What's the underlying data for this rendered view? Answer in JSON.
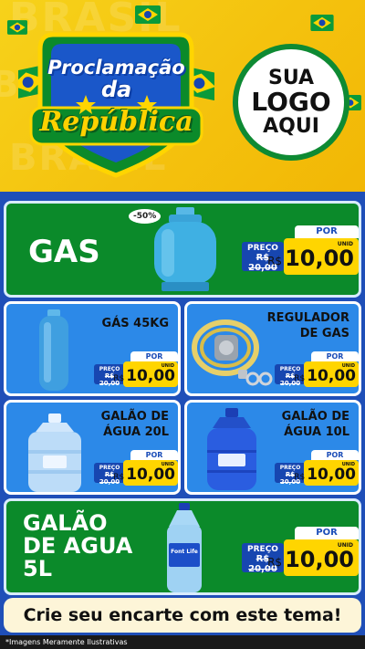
{
  "header": {
    "bg_word": "BRASIL",
    "title_line1": "Proclamação",
    "title_line2": "da",
    "title_line3": "República",
    "logo_line1": "SUA",
    "logo_line2": "LOGO",
    "logo_line3": "AQUI"
  },
  "colors": {
    "yellow": "#f4c20e",
    "green": "#0b8a2a",
    "blue": "#2c89e8",
    "dark_blue": "#1f4fb8"
  },
  "products": [
    {
      "name": "GAS",
      "discount": "-50%",
      "price_label": "PREÇO",
      "old_price": "R$ 20,00",
      "por_label": "POR",
      "currency": "R$",
      "price": "10,00",
      "unit": "UNID",
      "icon": "gas-cylinder-icon"
    },
    {
      "name": "GÁS 45KG",
      "price_label": "PREÇO",
      "old_price": "R$ 20,00",
      "por_label": "POR",
      "currency": "R$",
      "price": "10,00",
      "unit": "UNID",
      "icon": "tall-gas-cylinder-icon"
    },
    {
      "name_line1": "REGULADOR",
      "name_line2": "DE GAS",
      "price_label": "PREÇO",
      "old_price": "R$ 20,00",
      "por_label": "POR",
      "currency": "R$",
      "price": "10,00",
      "unit": "UNID",
      "icon": "gas-regulator-icon"
    },
    {
      "name_line1": "GALÃO DE",
      "name_line2": "ÁGUA 20L",
      "price_label": "PREÇO",
      "old_price": "R$ 20,00",
      "por_label": "POR",
      "currency": "R$",
      "price": "10,00",
      "unit": "UNID",
      "icon": "water-jug-20l-icon"
    },
    {
      "name_line1": "GALÃO DE",
      "name_line2": "ÁGUA 10L",
      "price_label": "PREÇO",
      "old_price": "R$ 20,00",
      "por_label": "POR",
      "currency": "R$",
      "price": "10,00",
      "unit": "UNID",
      "icon": "water-jug-10l-icon"
    },
    {
      "name_line1": "GALÃO",
      "name_line2": "DE AGUA",
      "name_line3": "5L",
      "brand": "Font Life",
      "price_label": "PREÇO",
      "old_price": "R$ 20,00",
      "por_label": "POR",
      "currency": "R$",
      "price": "10,00",
      "unit": "UNID",
      "icon": "water-bottle-5l-icon"
    }
  ],
  "cta": "Crie seu encarte com este tema!",
  "footer": "*Imagens Meramente Ilustrativas"
}
